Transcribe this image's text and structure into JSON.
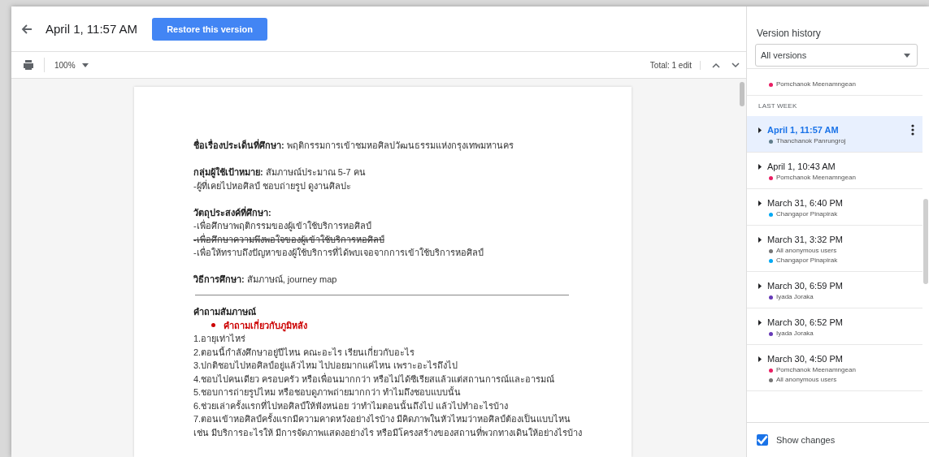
{
  "header": {
    "title": "April 1, 11:57 AM",
    "restore_button": "Restore this version"
  },
  "toolbar": {
    "zoom": "100%",
    "total": "Total: 1 edit"
  },
  "document": {
    "sections": [
      {
        "kind": "lines",
        "lines": [
          {
            "kind": "field",
            "label": "ชื่อเรื่องประเด็นที่ศึกษา:",
            "text": "พฤติกรรมการเข้าชมหอศิลปวัฒนธรรมแห่งกรุงเทพมหานคร"
          }
        ]
      },
      {
        "kind": "lines",
        "lines": [
          {
            "kind": "field",
            "label": "กลุ่มผู้ใช้เป้าหมาย:",
            "text": "สัมภาษณ์ประมาณ 5-7  คน"
          },
          {
            "kind": "text",
            "text": " -ผู้ที่เคยไปหอศิลป์ ชอบถ่ายรูป ดูงานศิลปะ"
          }
        ]
      },
      {
        "kind": "lines",
        "lines": [
          {
            "kind": "heading",
            "text": "วัตถุประสงค์ที่ศึกษา:"
          },
          {
            "kind": "text",
            "text": "-เพื่อศึกษาพฤติกรรมของผู้เข้าใช้บริการหอศิลป์"
          },
          {
            "kind": "struck",
            "text": "-เพื่อศึกษาความพึงพอใจของผู้เข้าใช้บริการหอศิลป์"
          },
          {
            "kind": "text",
            "text": "-เพื่อให้ทราบถึงปัญหาของผู้ใช้บริการที่ได้พบเจอจากการเข้าใช้บริการหอศิลป์"
          }
        ]
      },
      {
        "kind": "lines",
        "lines": [
          {
            "kind": "field",
            "label": "วิธีการศึกษา:",
            "text": "สัมภาษณ์, journey map"
          }
        ]
      },
      {
        "kind": "rule"
      },
      {
        "kind": "lines",
        "lines": [
          {
            "kind": "heading",
            "text": "คำถามสัมภาษณ์"
          },
          {
            "kind": "bullet",
            "text": "คำถามเกี่ยวกับภูมิหลัง"
          },
          {
            "kind": "text",
            "text": "1.อายุเท่าไหร่"
          },
          {
            "kind": "text",
            "text": "2.ตอนนี้กำลังศึกษาอยู่ปีไหน คณะอะไร เรียนเกี่ยวกับอะไร"
          },
          {
            "kind": "text",
            "text": "3.ปกติชอบไปหอศิลป์อยู่แล้วไหม ไปบ่อยมากแค่ไหน เพราะอะไรถึงไป"
          },
          {
            "kind": "text",
            "text": "4.ชอบไปคนเดียว ครอบครัว หรือเพื่อนมากกว่า หรือไม่ได้ซีเรียสแล้วแต่สถานการณ์และอารมณ์"
          },
          {
            "kind": "text",
            "text": "5.ชอบการถ่ายรูปไหม หรือชอบดูภาพถ่ายมากกว่า ทำไมถึงชอบแบบนั้น"
          },
          {
            "kind": "text",
            "text": "6.ช่วยเล่าครั้งแรกที่ไปหอศิลป์ให้ฟังหน่อย ว่าทำไมตอนนั้นถึงไป แล้วไปทำอะไรบ้าง"
          },
          {
            "kind": "text",
            "text": "7.ตอนเข้าหอศิลป์ครั้งแรกมีความคาดหวังอย่างไรบ้าง มีคิดภาพในหัวไหมว่าหอศิลป์ต้องเป็นแบบไหน เช่น มีบริการอะไรให้ มีการจัดภาพแสดงอย่างไร หรือมีโครงสร้างของสถานที่พวกทางเดินให้อย่างไรบ้าง"
          }
        ]
      }
    ]
  },
  "panel": {
    "title": "Version history",
    "filter": "All versions",
    "groups": [
      {
        "versions": [
          {
            "selected": false,
            "users": [
              {
                "name": "Pomchanok Meenamngean",
                "color": "#e91e63"
              }
            ]
          }
        ]
      },
      {
        "label": "LAST WEEK",
        "versions": [
          {
            "time": "April 1, 11:57 AM",
            "selected": true,
            "users": [
              {
                "name": "Thanchanok Panrungroj",
                "color": "#607d8b"
              }
            ]
          },
          {
            "time": "April 1, 10:43 AM",
            "selected": false,
            "users": [
              {
                "name": "Pomchanok Meenamngean",
                "color": "#e91e63"
              }
            ]
          },
          {
            "time": "March 31, 6:40 PM",
            "selected": false,
            "users": [
              {
                "name": "Changapor Pinapirak",
                "color": "#03a9f4"
              }
            ]
          },
          {
            "time": "March 31, 3:32 PM",
            "selected": false,
            "users": [
              {
                "name": "All anonymous users",
                "color": "#757575"
              },
              {
                "name": "Changapor Pinapirak",
                "color": "#03a9f4"
              }
            ]
          },
          {
            "time": "March 30, 6:59 PM",
            "selected": false,
            "users": [
              {
                "name": "Iyada Joraka",
                "color": "#673ab7"
              }
            ]
          },
          {
            "time": "March 30, 6:52 PM",
            "selected": false,
            "users": [
              {
                "name": "Iyada Joraka",
                "color": "#673ab7"
              }
            ]
          },
          {
            "time": "March 30, 4:50 PM",
            "selected": false,
            "users": [
              {
                "name": "Pomchanok Meenamngean",
                "color": "#e91e63"
              },
              {
                "name": "All anonymous users",
                "color": "#757575"
              }
            ]
          }
        ]
      }
    ],
    "show_changes": {
      "label": "Show changes",
      "checked": true
    }
  }
}
